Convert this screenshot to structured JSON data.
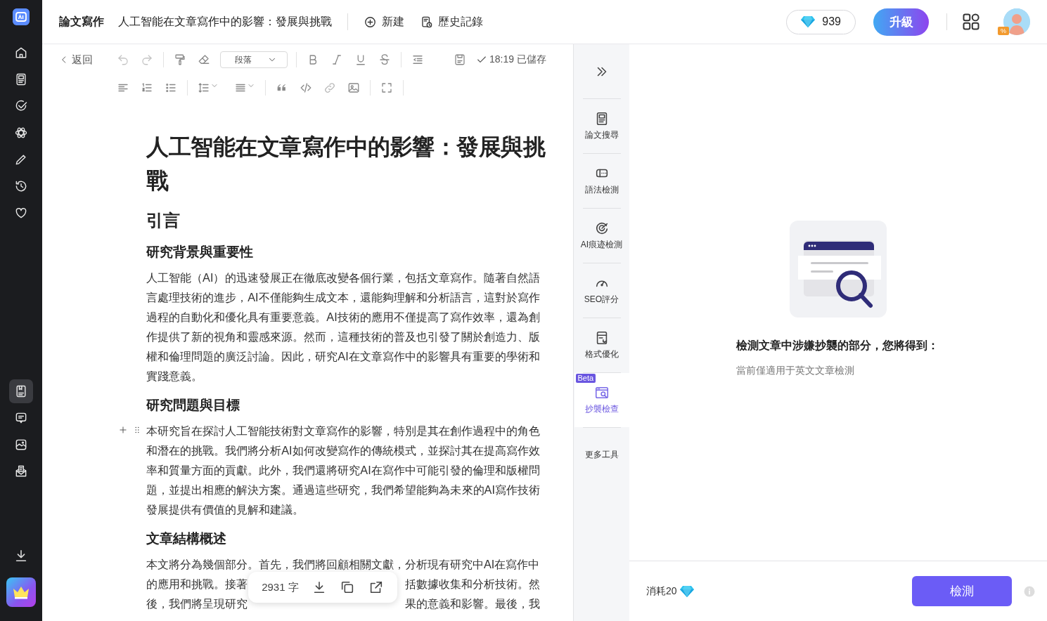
{
  "sidebar": {
    "top_items": [
      {
        "selected": false
      },
      {
        "selected": false
      },
      {
        "selected": false
      },
      {
        "selected": false
      },
      {
        "selected": false
      },
      {
        "selected": false
      },
      {
        "selected": false
      }
    ],
    "bottom_items": [
      {
        "selected": true
      },
      {
        "selected": false
      },
      {
        "selected": false
      },
      {
        "selected": false
      }
    ]
  },
  "topbar": {
    "section": "論文寫作",
    "document_title": "人工智能在文章寫作中的影響：發展與挑戰",
    "new_label": "新建",
    "history_label": "歷史記錄",
    "credits": "939",
    "upgrade_label": "升級",
    "avatar_badge": "%"
  },
  "editor": {
    "back_label": "返回",
    "block_style": "段落",
    "save_status": "18:19 已儲存",
    "blocks": [
      {
        "kind": "h1",
        "text": "人工智能在文章寫作中的影響：發展與挑戰"
      },
      {
        "kind": "h2",
        "text": "引言"
      },
      {
        "kind": "h3",
        "text": "研究背景與重要性"
      },
      {
        "kind": "p",
        "text": "人工智能（AI）的迅速發展正在徹底改變各個行業，包括文章寫作。隨著自然語言處理技術的進步，AI不僅能夠生成文本，還能夠理解和分析語言，這對於寫作過程的自動化和優化具有重要意義。AI技術的應用不僅提高了寫作效率，還為創作提供了新的視角和靈感來源。然而，這種技術的普及也引發了關於創造力、版權和倫理問題的廣泛討論。因此，研究AI在文章寫作中的影響具有重要的學術和實踐意義。"
      },
      {
        "kind": "h3",
        "text": "研究問題與目標"
      },
      {
        "kind": "p",
        "text": "本研究旨在探討人工智能技術對文章寫作的影響，特別是其在創作過程中的角色和潛在的挑戰。我們將分析AI如何改變寫作的傳統模式，並探討其在提高寫作效率和質量方面的貢獻。此外，我們還將研究AI在寫作中可能引發的倫理和版權問題，並提出相應的解決方案。通過這些研究，我們希望能夠為未來的AI寫作技術發展提供有價值的見解和建議。",
        "hovered": true
      },
      {
        "kind": "h3",
        "text": "文章結構概述"
      },
      {
        "kind": "lines",
        "lines": [
          [
            "本文將分為幾個部分。首先，我們將回顧相關文獻，分析現有研究中AI在寫作中"
          ],
          [
            "的應用和挑戰。接著",
            "括數據收集和分析技術。然"
          ],
          [
            "後，我們將呈現研究",
            "果的意義和影響。最後，我"
          ]
        ]
      }
    ],
    "word_count": "2931 字"
  },
  "tools": [
    {
      "label": "論文搜尋",
      "selected": false
    },
    {
      "label": "語法檢測",
      "selected": false
    },
    {
      "label": "AI痕迹檢測",
      "selected": false
    },
    {
      "label": "SEO評分",
      "selected": false
    },
    {
      "label": "格式優化",
      "selected": false
    },
    {
      "label": "抄襲檢查",
      "selected": true,
      "badge": "Beta"
    },
    {
      "label": "更多工具",
      "selected": false
    }
  ],
  "panel": {
    "heading": "檢測文章中涉嫌抄襲的部分，您將得到：",
    "note": "當前僅適用于英文文章檢測",
    "cost": "消耗20",
    "action": "檢測"
  }
}
